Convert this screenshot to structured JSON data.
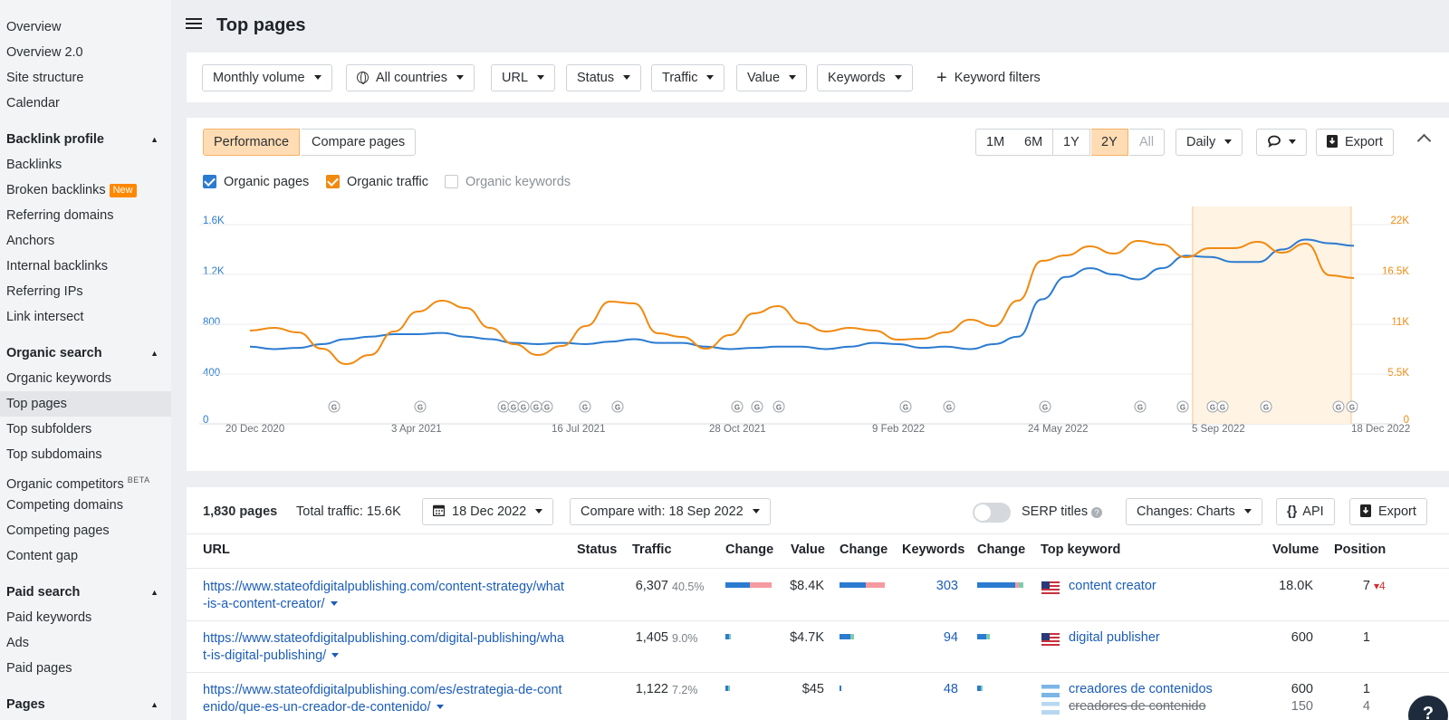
{
  "sidebar": {
    "top_items": [
      "Overview",
      "Overview 2.0",
      "Site structure",
      "Calendar"
    ],
    "backlink_profile": {
      "title": "Backlink profile",
      "items": [
        "Backlinks",
        "Broken backlinks",
        "Referring domains",
        "Anchors",
        "Internal backlinks",
        "Referring IPs",
        "Link intersect"
      ],
      "new_badge": "New"
    },
    "organic_search": {
      "title": "Organic search",
      "items": [
        "Organic keywords",
        "Top pages",
        "Top subfolders",
        "Top subdomains",
        "Organic competitors",
        "Competing domains",
        "Competing pages",
        "Content gap"
      ],
      "beta_badge": "BETA"
    },
    "paid_search": {
      "title": "Paid search",
      "items": [
        "Paid keywords",
        "Ads",
        "Paid pages"
      ]
    },
    "pages": {
      "title": "Pages"
    }
  },
  "header": {
    "title": "Top pages"
  },
  "filters": {
    "monthly_volume": "Monthly volume",
    "countries": "All countries",
    "url": "URL",
    "status": "Status",
    "traffic": "Traffic",
    "value": "Value",
    "keywords": "Keywords",
    "keyword_filters": "Keyword filters"
  },
  "chart_controls": {
    "tabs": [
      "Performance",
      "Compare pages"
    ],
    "ranges": [
      "1M",
      "6M",
      "1Y",
      "2Y",
      "All"
    ],
    "active_range": "2Y",
    "interval": "Daily",
    "export": "Export",
    "series_toggles": [
      {
        "label": "Organic pages",
        "checked": true,
        "color": "#2b7bd1"
      },
      {
        "label": "Organic traffic",
        "checked": true,
        "color": "#f08a10"
      },
      {
        "label": "Organic keywords",
        "checked": false
      }
    ]
  },
  "chart_data": {
    "type": "line",
    "x_ticks": [
      "20 Dec 2020",
      "3 Apr 2021",
      "16 Jul 2021",
      "28 Oct 2021",
      "9 Feb 2022",
      "24 May 2022",
      "5 Sep 2022",
      "18 Dec 2022"
    ],
    "y_left_ticks": [
      "0",
      "400",
      "800",
      "1.2K",
      "1.6K"
    ],
    "y_right_ticks": [
      "0",
      "5.5K",
      "11K",
      "16.5K",
      "22K"
    ],
    "y_left_range": [
      0,
      1600
    ],
    "y_right_range": [
      0,
      22000
    ],
    "grid": true,
    "highlight_range": [
      "5 Sep 2022",
      "18 Dec 2022"
    ],
    "google_update_markers": 24,
    "series": [
      {
        "name": "Organic pages",
        "axis": "left",
        "color": "#2b7bd1",
        "values": [
          620,
          600,
          610,
          640,
          680,
          700,
          720,
          720,
          730,
          700,
          680,
          650,
          640,
          650,
          640,
          660,
          680,
          650,
          650,
          620,
          600,
          610,
          620,
          620,
          600,
          620,
          650,
          640,
          610,
          620,
          600,
          640,
          700,
          1000,
          1180,
          1250,
          1200,
          1160,
          1250,
          1350,
          1340,
          1300,
          1300,
          1400,
          1480,
          1450,
          1430
        ]
      },
      {
        "name": "Organic traffic",
        "axis": "right",
        "color": "#f08a10",
        "values": [
          10300,
          10600,
          10100,
          8300,
          6600,
          7600,
          10200,
          12400,
          13600,
          12800,
          10600,
          8800,
          7600,
          8600,
          10800,
          13500,
          13300,
          10000,
          9600,
          8300,
          9800,
          12200,
          13000,
          11100,
          10200,
          10600,
          10300,
          9300,
          9400,
          10100,
          11500,
          10800,
          13600,
          18000,
          18600,
          19600,
          18800,
          20200,
          19800,
          18400,
          19400,
          19400,
          20100,
          18900,
          19900,
          16400,
          16100
        ]
      }
    ]
  },
  "table": {
    "pages_count": "1,830 pages",
    "total_traffic": "Total traffic: 15.6K",
    "date": "18 Dec 2022",
    "compare_with": "Compare with: 18 Sep 2022",
    "serp_titles": "SERP titles",
    "changes": "Changes: Charts",
    "api": "API",
    "export": "Export",
    "columns": [
      "URL",
      "Status",
      "Traffic",
      "Change",
      "Value",
      "Change",
      "Keywords",
      "Change",
      "Top keyword",
      "Volume",
      "Position"
    ],
    "rows": [
      {
        "url": "https://www.stateofdigitalpublishing.com/content-strategy/what-is-a-content-creator/",
        "traffic": "6,307",
        "traffic_pct": "40.5%",
        "traffic_share": 0.405,
        "value": "$8.4K",
        "keywords": "303",
        "top_keyword": "content creator",
        "flag": "us",
        "volume": "18.0K",
        "position": "7",
        "position_change": "4"
      },
      {
        "url": "https://www.stateofdigitalpublishing.com/digital-publishing/what-is-digital-publishing/",
        "traffic": "1,405",
        "traffic_pct": "9.0%",
        "traffic_share": 0.09,
        "value": "$4.7K",
        "keywords": "94",
        "top_keyword": "digital publisher",
        "flag": "us",
        "volume": "600",
        "position": "1"
      },
      {
        "url": "https://www.stateofdigitalpublishing.com/es/estrategia-de-contenido/que-es-un-creador-de-contenido/",
        "traffic": "1,122",
        "traffic_pct": "7.2%",
        "traffic_share": 0.072,
        "value": "$45",
        "keywords": "48",
        "top_keyword": "creadores de contenidos",
        "flag": "ar",
        "volume": "600",
        "position": "1",
        "prev_keyword": "creadores de contenido",
        "prev_volume": "150",
        "prev_position": "4"
      }
    ]
  },
  "help": "?"
}
